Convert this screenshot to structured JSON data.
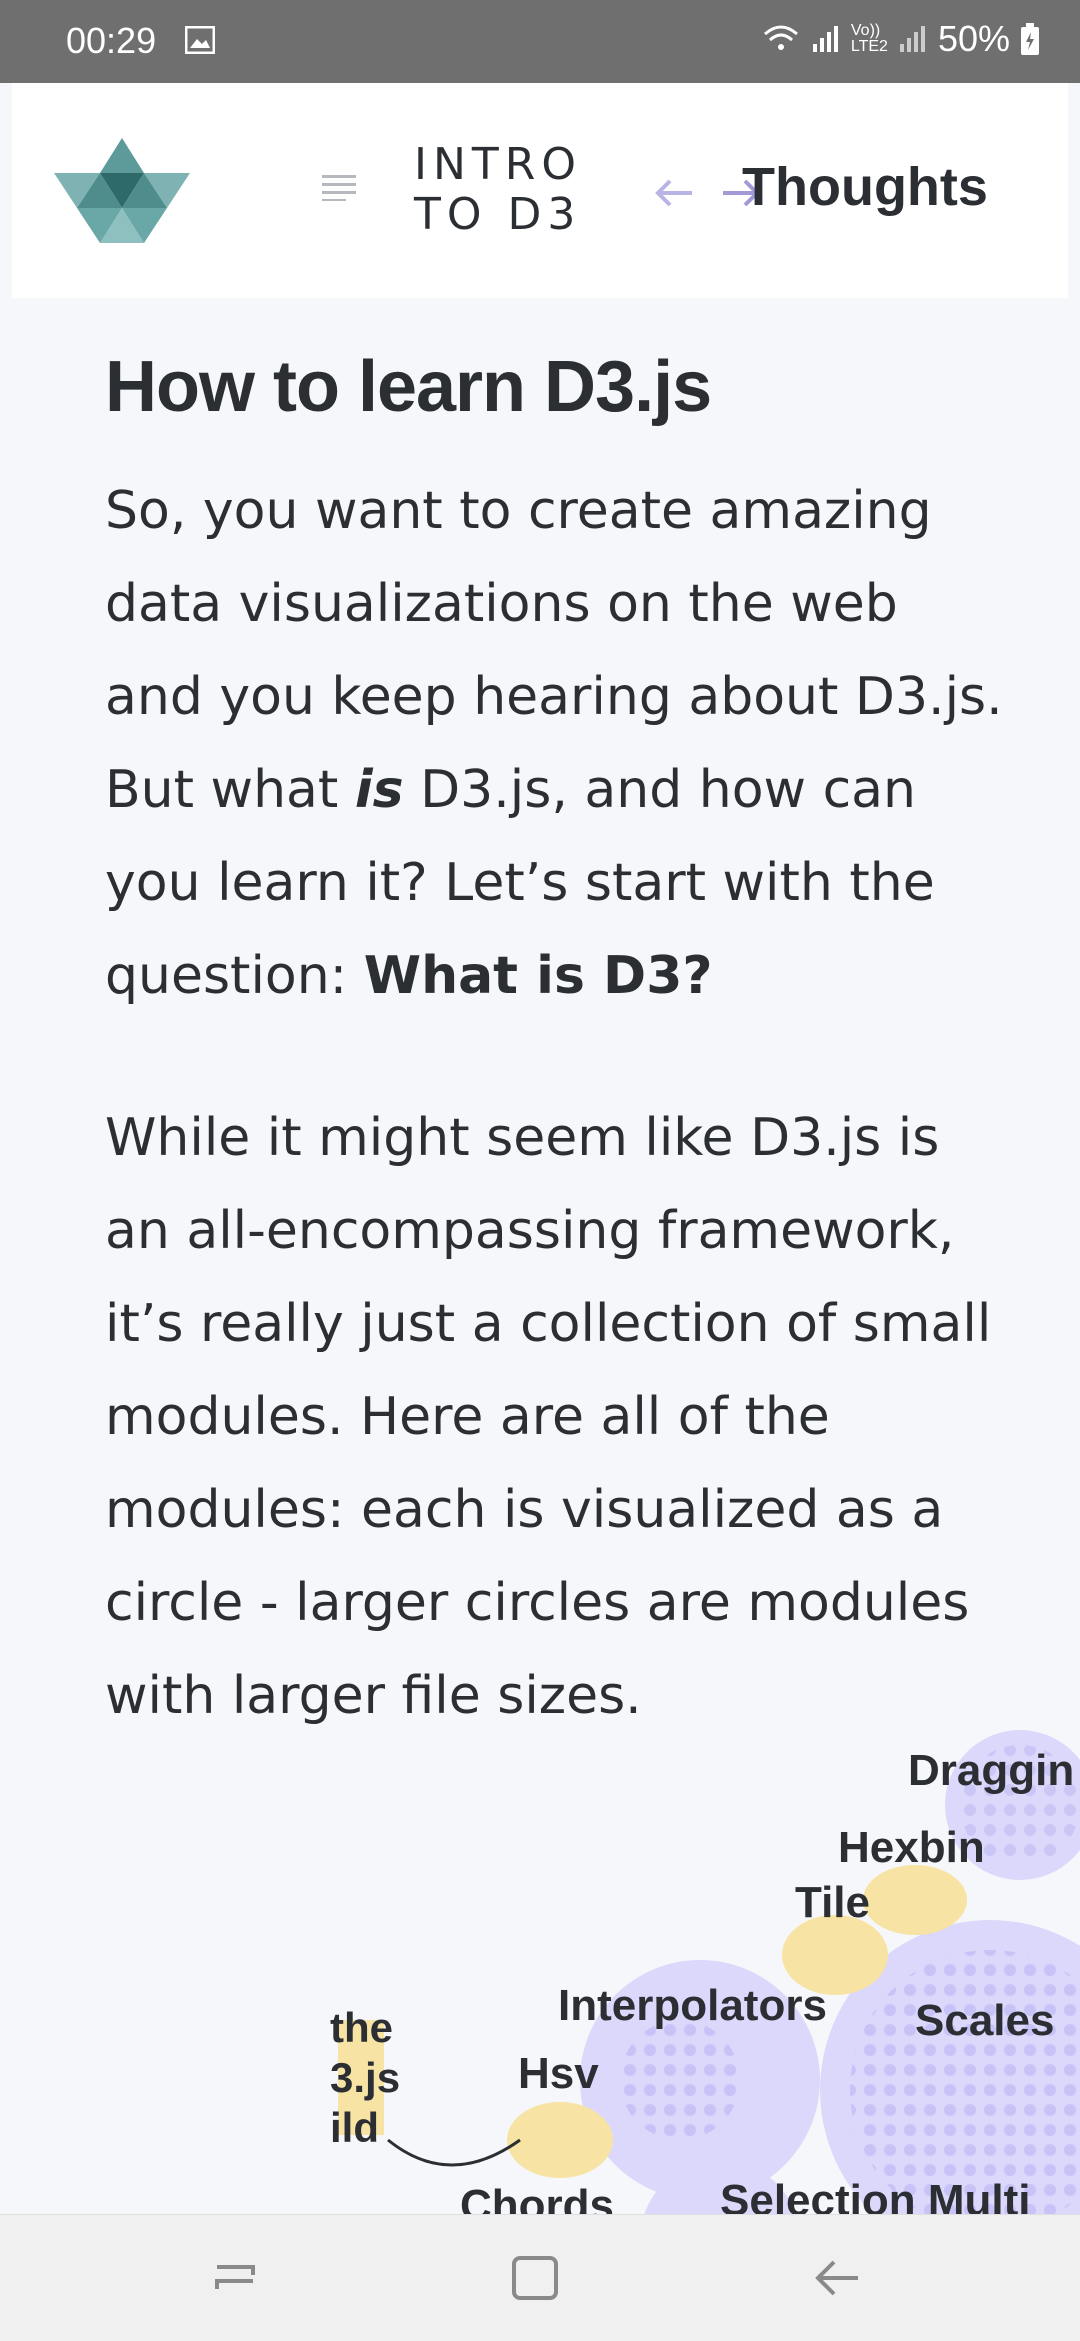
{
  "status": {
    "time": "00:29",
    "battery": "50%",
    "network": "LTE2",
    "network_sub": "Vo))"
  },
  "header": {
    "brand_icon": "polymer-logo-icon",
    "menu_icon": "menu-icon",
    "title_line1": "INTRO",
    "title_line2": "TO D3",
    "prev_icon": "arrow-left-icon",
    "next_icon": "arrow-right-icon",
    "next_label": "Thoughts"
  },
  "article": {
    "heading": "How to learn D3.js",
    "p1_a": "So, you want to create amazing data visualizations on the web and you keep hearing about D3.js. But what ",
    "p1_em": "is",
    "p1_b": " D3.js, and how can you learn it? Let’s start with the question: ",
    "p1_strong": "What is D3?",
    "p2": "While it might seem like D3.js is an all-encompassing framework, it’s really just a collection of small modules. Here are all of the modules: each is visualized as a circle - larger circles are modules with larger file sizes."
  },
  "viz_labels": {
    "dragging": "Draggin",
    "hexbin": "Hexbin",
    "tile": "Tile",
    "interpolators": "Interpolators",
    "scales": "Scales",
    "hsv": "Hsv",
    "chords": "Chords",
    "selection_multi": "Selection Multi",
    "the": "the",
    "djs": "3.js",
    "build": "ild"
  },
  "colors": {
    "accent_purple": "#d9d6f9",
    "accent_yellow": "#f7e3a3",
    "logo_teal": "#6aa8a8",
    "logo_dark": "#2f6a6a"
  },
  "navbar": {
    "recents_icon": "recents-icon",
    "home_icon": "home-icon",
    "back_icon": "back-icon"
  }
}
